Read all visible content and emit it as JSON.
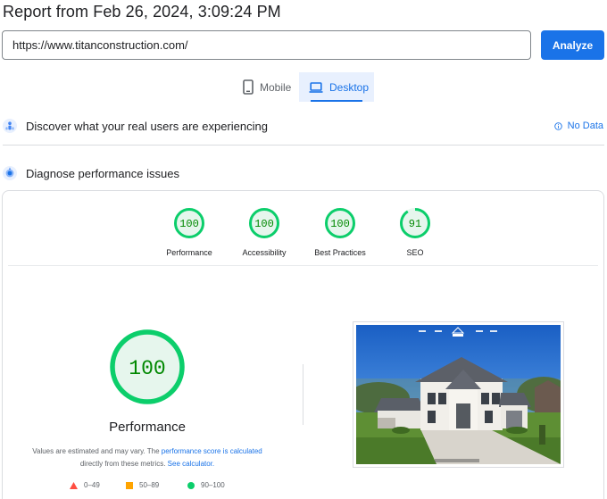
{
  "report": {
    "title": "Report from Feb 26, 2024, 3:09:24 PM"
  },
  "search": {
    "url": "https://www.titanconstruction.com/",
    "analyze_label": "Analyze"
  },
  "tabs": [
    {
      "label": "Mobile",
      "icon": "smartphone-icon",
      "selected": false
    },
    {
      "label": "Desktop",
      "icon": "laptop-icon",
      "selected": true
    }
  ],
  "field_data": {
    "title": "Discover what your real users are experiencing",
    "status": "No Data"
  },
  "lab": {
    "title": "Diagnose performance issues"
  },
  "scores": [
    {
      "label": "Performance",
      "score": "100"
    },
    {
      "label": "Accessibility",
      "score": "100"
    },
    {
      "label": "Best Practices",
      "score": "100"
    },
    {
      "label": "SEO",
      "score": "91"
    }
  ],
  "main_score": {
    "score": "100",
    "label": "Performance",
    "note_1": "Values are estimated and may vary. The ",
    "note_link_1": "performance score is calculated",
    "note_2": "directly from these metrics. ",
    "note_link_2": "See calculator."
  },
  "legend": [
    {
      "range": "0–49",
      "color": "#ff4e42",
      "shape": "triangle"
    },
    {
      "range": "50–89",
      "color": "#ffa400",
      "shape": "square"
    },
    {
      "range": "90–100",
      "color": "#0cce6b",
      "shape": "circle"
    }
  ],
  "colors": {
    "accent": "#1a73e8",
    "pass": "#0cce6b",
    "pass_text": "#008800",
    "pass_fill": "#e6f6ed"
  }
}
